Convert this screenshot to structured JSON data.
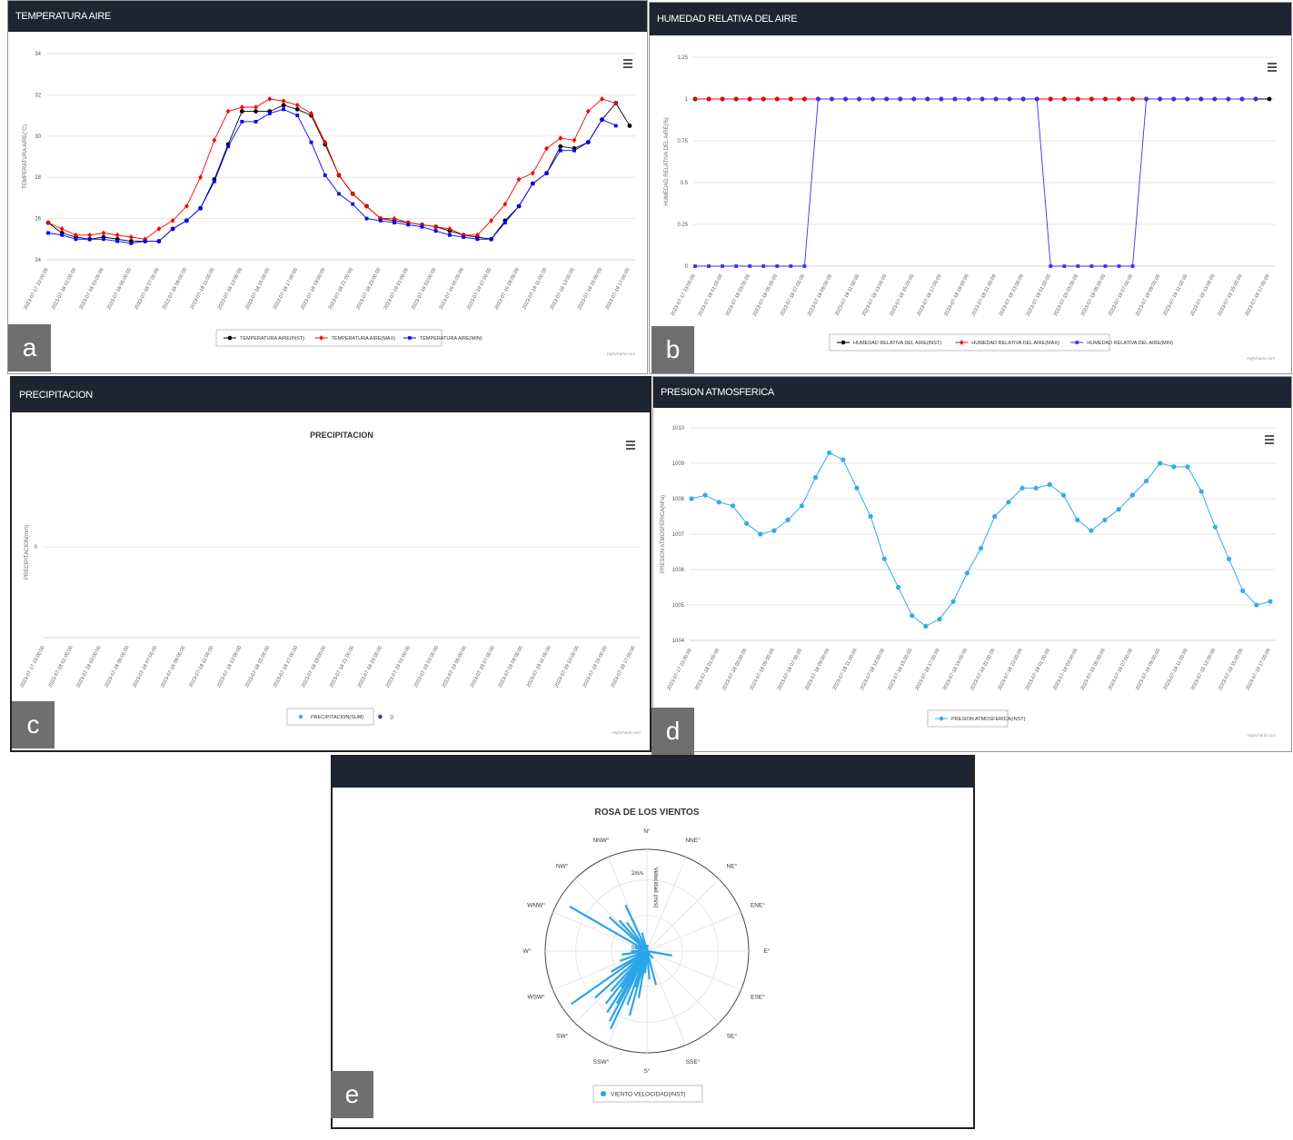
{
  "panels": {
    "a": {
      "header": "TEMPERATURA AIRE",
      "tag": "a",
      "credit": "Highcharts.com"
    },
    "b": {
      "header": "HUMEDAD RELATIVA DEL AIRE",
      "tag": "b",
      "credit": "Highcharts.com"
    },
    "c": {
      "header": "PRECIPITACION",
      "tag": "c",
      "credit": "Highcharts.com"
    },
    "d": {
      "header": "PRESION ATMOSFERICA",
      "tag": "d",
      "credit": "Highcharts.com"
    },
    "e": {
      "header": "",
      "tag": "e"
    }
  },
  "x_labels_a": [
    "2023-07-17 23:00:00",
    "2023-07-18 01:00:00",
    "2023-07-18 03:00:00",
    "2023-07-18 05:00:00",
    "2023-07-18 07:00:00",
    "2023-07-18 09:00:00",
    "2023-07-18 11:00:00",
    "2023-07-18 13:00:00",
    "2023-07-18 15:00:00",
    "2023-07-18 17:00:00",
    "2023-07-18 19:00:00",
    "2023-07-18 21:00:00",
    "2023-07-18 23:00:00",
    "2023-07-19 01:00:00",
    "2023-07-19 03:00:00",
    "2023-07-19 05:00:00",
    "2023-07-19 07:00:00",
    "2023-07-19 09:00:00",
    "2023-07-19 11:00:00",
    "2023-07-19 13:00:00",
    "2023-07-19 15:00:00",
    "2023-07-19 17:00:00"
  ],
  "chart_data": [
    {
      "id": "a",
      "type": "line",
      "ylabel": "TEMPERATURA AIRE(°C)",
      "ylim": [
        24,
        34
      ],
      "yticks": [
        24,
        26,
        28,
        30,
        32,
        34
      ],
      "x_index": [
        0,
        1,
        2,
        3,
        4,
        5,
        6,
        7,
        8,
        9,
        10,
        11,
        12,
        13,
        14,
        15,
        16,
        17,
        18,
        19,
        20,
        21,
        22,
        23,
        24,
        25,
        26,
        27,
        28,
        29,
        30,
        31,
        32,
        33,
        34,
        35,
        36,
        37,
        38,
        39,
        40,
        41,
        42
      ],
      "grid": true,
      "legend": "bottom-center",
      "series": [
        {
          "name": "TEMPERATURA AIRE(INST)",
          "color": "#000000",
          "marker": "circle",
          "values": [
            25.8,
            25.3,
            25.1,
            25.0,
            25.1,
            25.0,
            24.9,
            24.9,
            24.9,
            25.5,
            25.9,
            26.5,
            27.9,
            29.6,
            31.2,
            31.2,
            31.2,
            31.5,
            31.3,
            31.0,
            29.6,
            28.1,
            27.2,
            26.6,
            26.0,
            25.9,
            25.8,
            25.7,
            25.6,
            25.4,
            25.2,
            25.1,
            25.0,
            25.9,
            26.6,
            27.7,
            28.2,
            29.5,
            29.4,
            29.7,
            30.8,
            31.6,
            30.5
          ]
        },
        {
          "name": "TEMPERATURA AIRE(MAX)",
          "color": "#ff0000",
          "marker": "diamond",
          "values": [
            25.8,
            25.5,
            25.2,
            25.2,
            25.3,
            25.2,
            25.1,
            25.0,
            25.5,
            25.9,
            26.6,
            28.0,
            29.8,
            31.2,
            31.4,
            31.4,
            31.8,
            31.7,
            31.5,
            31.1,
            29.7,
            28.1,
            27.2,
            26.6,
            26.0,
            26.0,
            25.8,
            25.7,
            25.6,
            25.5,
            25.2,
            25.2,
            25.9,
            26.7,
            27.9,
            28.2,
            29.4,
            29.9,
            29.8,
            31.2,
            31.8,
            31.6,
            null
          ]
        },
        {
          "name": "TEMPERATURA AIRE(MIN)",
          "color": "#0000ff",
          "marker": "square",
          "values": [
            25.3,
            25.2,
            25.0,
            25.0,
            25.0,
            24.9,
            24.8,
            24.9,
            24.9,
            25.5,
            25.9,
            26.5,
            27.8,
            29.5,
            30.7,
            30.7,
            31.1,
            31.3,
            31.0,
            29.7,
            28.1,
            27.2,
            26.7,
            26.0,
            25.9,
            25.8,
            25.7,
            25.6,
            25.4,
            25.2,
            25.1,
            25.0,
            25.0,
            25.8,
            26.6,
            27.7,
            28.2,
            29.3,
            29.3,
            29.7,
            30.8,
            30.5,
            null
          ]
        }
      ]
    },
    {
      "id": "b",
      "type": "line",
      "ylabel": "HUMEDAD RELATIVA DEL AIRE(%)",
      "ylim": [
        0,
        1.25
      ],
      "yticks": [
        0,
        0.25,
        0.5,
        0.75,
        1,
        1.25
      ],
      "grid": true,
      "legend": "bottom-center",
      "series": [
        {
          "name": "HUMEDAD RELATIVA DEL AIRE(INST)",
          "color": "#000000",
          "marker": "circle",
          "values": [
            1,
            1,
            1,
            1,
            1,
            1,
            1,
            1,
            1,
            1,
            1,
            1,
            1,
            1,
            1,
            1,
            1,
            1,
            1,
            1,
            1,
            1,
            1,
            1,
            1,
            1,
            1,
            1,
            1,
            1,
            1,
            1,
            1,
            1,
            1,
            1,
            1,
            1,
            1,
            1,
            1,
            1,
            1
          ]
        },
        {
          "name": "HUMEDAD RELATIVA DEL AIRE(MAX)",
          "color": "#ff0000",
          "marker": "diamond",
          "values": [
            1,
            1,
            1,
            1,
            1,
            1,
            1,
            1,
            1,
            1,
            1,
            1,
            1,
            1,
            1,
            1,
            1,
            1,
            1,
            1,
            1,
            1,
            1,
            1,
            1,
            1,
            1,
            1,
            1,
            1,
            1,
            1,
            1,
            1,
            1,
            1,
            1,
            1,
            1,
            1,
            1,
            1,
            null
          ]
        },
        {
          "name": "HUMEDAD RELATIVA DEL AIRE(MIN)",
          "color": "#3333ff",
          "marker": "square",
          "values": [
            0,
            0,
            0,
            0,
            0,
            0,
            0,
            0,
            0,
            1,
            1,
            1,
            1,
            1,
            1,
            1,
            1,
            1,
            1,
            1,
            1,
            1,
            1,
            1,
            1,
            1,
            0,
            0,
            0,
            0,
            0,
            0,
            0,
            1,
            1,
            1,
            1,
            1,
            1,
            1,
            1,
            1,
            null
          ]
        }
      ]
    },
    {
      "id": "c",
      "type": "line",
      "title": "PRECIPITACION",
      "ylabel": "PRECIPITACION(mm)",
      "yticks": [
        0
      ],
      "grid": true,
      "legend": "bottom-center",
      "series": [
        {
          "name": "PRECIPITACION(SUM)",
          "color": "#4fb3f0",
          "marker": "circle",
          "values": []
        },
        {
          "name": "()",
          "color": "#434399",
          "marker": "circle",
          "values": []
        }
      ]
    },
    {
      "id": "d",
      "type": "line",
      "ylabel": "PRESION ATMOSFERICA(hPa)",
      "ylim": [
        1004,
        1010
      ],
      "yticks": [
        1004,
        1005,
        1006,
        1007,
        1008,
        1009,
        1010
      ],
      "grid": true,
      "legend": "bottom-center",
      "series": [
        {
          "name": "PRESION ATMOSFERICA(INST)",
          "color": "#33aaee",
          "marker": "circle",
          "values": [
            1008.0,
            1008.1,
            1007.9,
            1007.8,
            1007.3,
            1007.0,
            1007.1,
            1007.4,
            1007.8,
            1008.6,
            1009.3,
            1009.1,
            1008.3,
            1007.5,
            1006.3,
            1005.5,
            1004.7,
            1004.4,
            1004.6,
            1005.1,
            1005.9,
            1006.6,
            1007.5,
            1007.9,
            1008.3,
            1008.3,
            1008.4,
            1008.1,
            1007.4,
            1007.1,
            1007.4,
            1007.7,
            1008.1,
            1008.5,
            1009.0,
            1008.9,
            1008.9,
            1008.2,
            1007.2,
            1006.3,
            1005.4,
            1005.0,
            1005.1
          ]
        }
      ]
    },
    {
      "id": "e",
      "type": "polar",
      "title": "ROSA DE LOS VIENTOS",
      "axis_label": "Velocidad (m/s)",
      "radial_ticks": [
        "0m/s",
        "2m/s"
      ],
      "directions": [
        "N°",
        "NNE°",
        "NE°",
        "ENE°",
        "E°",
        "ESE°",
        "SE°",
        "SSE°",
        "S°",
        "SSW°",
        "SW°",
        "WSW°",
        "W°",
        "WNW°",
        "NW°",
        "NNW°"
      ],
      "series": [
        {
          "name": "VIENTO VELOCIDAD(INST)",
          "color": "#2aa5e8",
          "points": [
            {
              "dir": 300,
              "speed": 2.8
            },
            {
              "dir": 312,
              "speed": 1.6
            },
            {
              "dir": 318,
              "speed": 1.3
            },
            {
              "dir": 325,
              "speed": 1.1
            },
            {
              "dir": 335,
              "speed": 1.6
            },
            {
              "dir": 345,
              "speed": 0.6
            },
            {
              "dir": 5,
              "speed": 0.2
            },
            {
              "dir": 100,
              "speed": 0.8
            },
            {
              "dir": 140,
              "speed": 0.3
            },
            {
              "dir": 165,
              "speed": 1.1
            },
            {
              "dir": 175,
              "speed": 0.9
            },
            {
              "dir": 190,
              "speed": 1.5
            },
            {
              "dir": 195,
              "speed": 2.1
            },
            {
              "dir": 200,
              "speed": 1.8
            },
            {
              "dir": 205,
              "speed": 2.7
            },
            {
              "dir": 208,
              "speed": 2.5
            },
            {
              "dir": 210,
              "speed": 1.9
            },
            {
              "dir": 213,
              "speed": 2.3
            },
            {
              "dir": 218,
              "speed": 2.1
            },
            {
              "dir": 222,
              "speed": 1.7
            },
            {
              "dir": 228,
              "speed": 2.2
            },
            {
              "dir": 235,
              "speed": 2.9
            },
            {
              "dir": 240,
              "speed": 1.3
            },
            {
              "dir": 250,
              "speed": 0.9
            },
            {
              "dir": 262,
              "speed": 0.8
            },
            {
              "dir": 270,
              "speed": 0.5
            },
            {
              "dir": 285,
              "speed": 0.4
            },
            {
              "dir": 215,
              "speed": 1.4
            },
            {
              "dir": 198,
              "speed": 1.2
            },
            {
              "dir": 185,
              "speed": 0.7
            }
          ]
        }
      ]
    }
  ]
}
